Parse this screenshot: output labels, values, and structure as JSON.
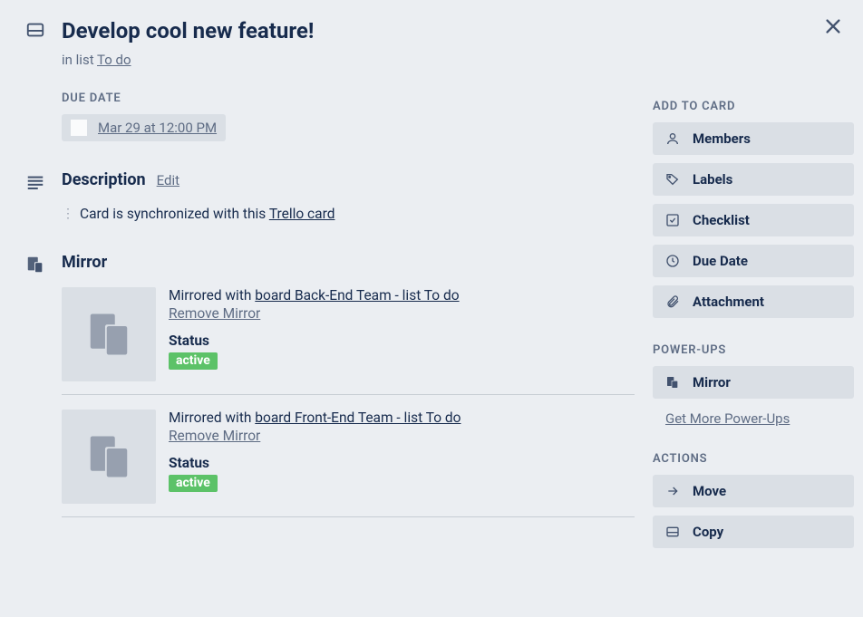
{
  "header": {
    "title": "Develop cool new feature!",
    "in_list_prefix": "in list ",
    "in_list_name": "To do"
  },
  "due": {
    "section_label": "DUE DATE",
    "text": "Mar 29 at 12:00 PM"
  },
  "description": {
    "title": "Description",
    "edit_label": "Edit",
    "body_prefix": "Card is synchronized with this ",
    "body_link": "Trello card"
  },
  "mirror": {
    "title": "Mirror",
    "items": [
      {
        "prefix": "Mirrored with ",
        "link": "board Back-End Team - list To do",
        "remove": "Remove Mirror",
        "status_label": "Status",
        "status_value": "active"
      },
      {
        "prefix": "Mirrored with ",
        "link": "board Front-End Team - list To do",
        "remove": "Remove Mirror",
        "status_label": "Status",
        "status_value": "active"
      }
    ]
  },
  "sidebar": {
    "add_label": "ADD TO CARD",
    "add": {
      "members": "Members",
      "labels": "Labels",
      "checklist": "Checklist",
      "due_date": "Due Date",
      "attachment": "Attachment"
    },
    "powerups_label": "POWER-UPS",
    "powerups": {
      "mirror": "Mirror",
      "more_link": "Get More Power-Ups"
    },
    "actions_label": "ACTIONS",
    "actions": {
      "move": "Move",
      "copy": "Copy"
    }
  }
}
